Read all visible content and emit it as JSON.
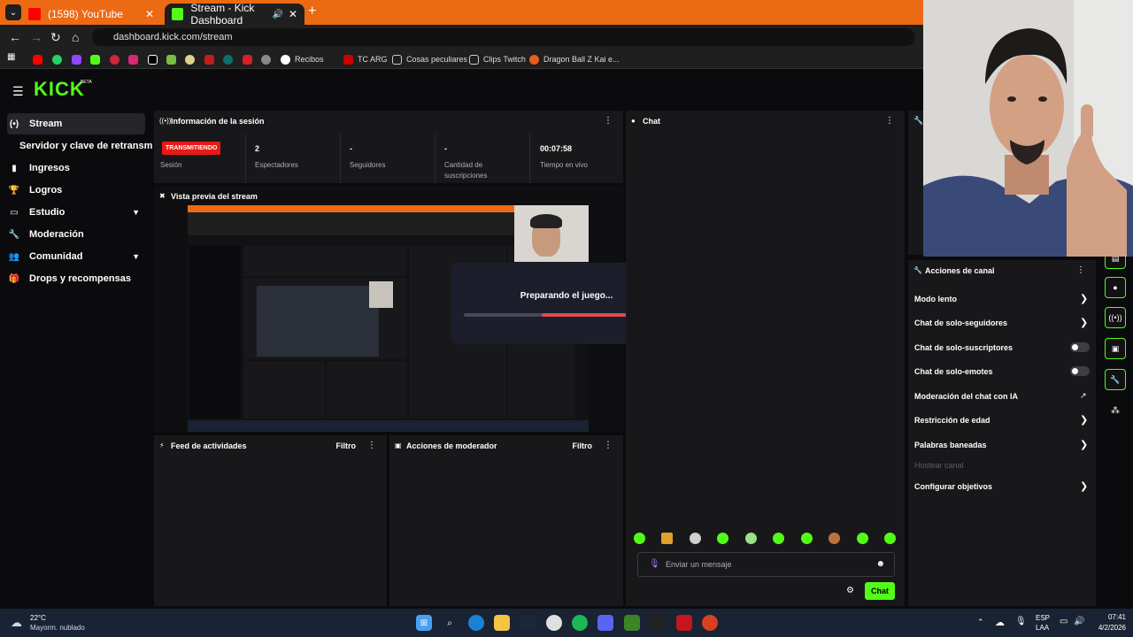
{
  "browser": {
    "tabs": [
      {
        "label": "(1598) YouTube",
        "close": "✕"
      },
      {
        "label": "Stream - Kick Dashboard",
        "close": "✕"
      }
    ],
    "new_tab": "+",
    "url": "dashboard.kick.com/stream",
    "bookmarks": [
      "Recibos",
      "TC ARG",
      "Cosas peculiares",
      "Clips Twitch",
      "Dragon Ball Z Kai e..."
    ]
  },
  "kick": {
    "logo": "KICK",
    "beta": "BETA"
  },
  "sidebar": {
    "items": [
      {
        "label": "Stream",
        "icon": "(•)"
      },
      {
        "label": "Servidor y clave de retransmisi",
        "icon": ""
      },
      {
        "label": "Ingresos",
        "icon": "▮"
      },
      {
        "label": "Logros",
        "icon": "🏆"
      },
      {
        "label": "Estudio",
        "icon": "▭"
      },
      {
        "label": "Moderación",
        "icon": "🔧"
      },
      {
        "label": "Comunidad",
        "icon": "👥"
      },
      {
        "label": "Drops y recompensas",
        "icon": "🎁"
      }
    ]
  },
  "session": {
    "title": "Información de la sesión",
    "badge": "TRANSMITIENDO",
    "stats": [
      {
        "value": "",
        "label": "Sesión"
      },
      {
        "value": "2",
        "label": "Espectadores"
      },
      {
        "value": "-",
        "label": "Seguidores"
      },
      {
        "value": "-",
        "label": "Cantidad de suscripciones"
      },
      {
        "value": "00:07:58",
        "label": "Tiempo en vivo"
      }
    ]
  },
  "preview": {
    "title": "Vista previa del stream"
  },
  "loading": {
    "text": "Preparando el juego...",
    "progress": 0.62
  },
  "feed": {
    "title": "Feed de actividades",
    "filter": "Filtro"
  },
  "modactions": {
    "title": "Acciones de moderador",
    "filter": "Filtro"
  },
  "chat": {
    "title": "Chat",
    "placeholder": "Enviar un mensaje",
    "send": "Chat"
  },
  "channel_actions": {
    "title": "Acciones de canal",
    "items": [
      {
        "label": "Modo lento",
        "control": "chevron"
      },
      {
        "label": "Chat de solo-seguidores",
        "control": "chevron"
      },
      {
        "label": "Chat de solo-suscriptores",
        "control": "toggle"
      },
      {
        "label": "Chat de solo-emotes",
        "control": "toggle"
      },
      {
        "label": "Moderación del chat con IA",
        "control": "external"
      },
      {
        "label": "Restricción de edad",
        "control": "chevron"
      },
      {
        "label": "Palabras baneadas",
        "control": "chevron"
      },
      {
        "label": "Hostear canal",
        "control": "disabled"
      },
      {
        "label": "Configurar objetivos",
        "control": "chevron"
      }
    ]
  },
  "taskbar": {
    "weather_temp": "22°C",
    "weather_desc": "Mayorm. nublado",
    "lang": "ESP",
    "lang2": "LAA",
    "time": "07:41",
    "date": "4/2/2026"
  },
  "colors": {
    "accent": "#53fc18",
    "live": "#e91916",
    "browser_tabstrip": "#ec6a14"
  }
}
